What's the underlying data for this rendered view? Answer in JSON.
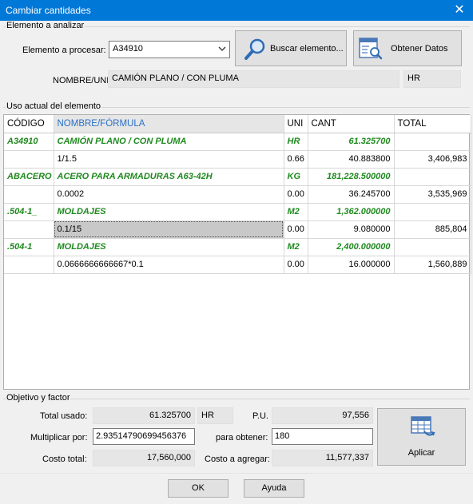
{
  "window": {
    "title": "Cambiar cantidades",
    "close_glyph": "✕"
  },
  "element_group": {
    "label": "Elemento a analizar",
    "process_label": "Elemento a procesar:",
    "process_value": "A34910",
    "search_button": "Buscar elemento...",
    "data_button": "Obtener Datos",
    "name_uni_label": "NOMBRE/UNI",
    "name_value": "CAMIÓN PLANO / CON PLUMA",
    "uni_value": "HR"
  },
  "usage_group": {
    "label": "Uso actual del elemento",
    "columns": [
      "CÓDIGO",
      "NOMBRE/FÓRMULA",
      "UNI",
      "CANT",
      "TOTAL"
    ],
    "rows": [
      {
        "type": "group",
        "cells": [
          "A34910",
          "CAMIÓN PLANO / CON PLUMA",
          "HR",
          "61.325700",
          ""
        ]
      },
      {
        "type": "detail",
        "cells": [
          "",
          "1/1.5",
          "0.66",
          "40.883800",
          "3,406,983"
        ]
      },
      {
        "type": "group",
        "cells": [
          "ABACERO",
          "ACERO PARA ARMADURAS A63-42H",
          "KG",
          "181,228.500000",
          ""
        ]
      },
      {
        "type": "detail",
        "cells": [
          "",
          "0.0002",
          "0.00",
          "36.245700",
          "3,535,969"
        ]
      },
      {
        "type": "group",
        "cells": [
          ".504-1_",
          "MOLDAJES",
          "M2",
          "1,362.000000",
          ""
        ]
      },
      {
        "type": "detail",
        "cells": [
          "",
          "0.1/15",
          "0.00",
          "9.080000",
          "885,804"
        ],
        "selected": true
      },
      {
        "type": "group",
        "cells": [
          ".504-1",
          "MOLDAJES",
          "M2",
          "2,400.000000",
          ""
        ]
      },
      {
        "type": "detail",
        "cells": [
          "",
          "0.0666666666667*0.1",
          "0.00",
          "16.000000",
          "1,560,889"
        ]
      }
    ]
  },
  "objective_group": {
    "label": "Objetivo y factor",
    "total_used_label": "Total usado:",
    "total_used_value": "61.325700",
    "total_used_uni": "HR",
    "pu_label": "P.U.",
    "pu_value": "97,556",
    "multiply_label": "Multiplicar por:",
    "multiply_value": "2.93514790699456376",
    "obtain_label": "para obtener:",
    "obtain_value": "180",
    "total_cost_label": "Costo total:",
    "total_cost_value": "17,560,000",
    "add_cost_label": "Costo a agregar:",
    "add_cost_value": "11,577,337",
    "apply_button": "Aplicar"
  },
  "footer": {
    "ok_button": "OK",
    "help_button": "Ayuda"
  },
  "colors": {
    "titlebar": "#0078d7",
    "group_row_text": "#1f8a1f",
    "active_header": "#2a71c7"
  }
}
